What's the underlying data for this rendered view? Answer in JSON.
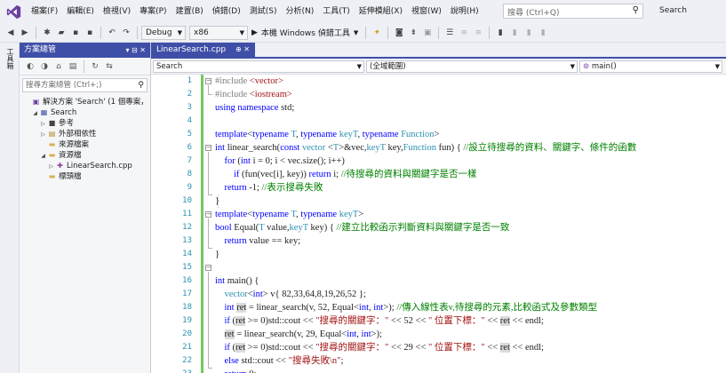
{
  "menu": {
    "items": [
      "檔案(F)",
      "編輯(E)",
      "檢視(V)",
      "專案(P)",
      "建置(B)",
      "偵錯(D)",
      "測試(S)",
      "分析(N)",
      "工具(T)",
      "延伸模組(X)",
      "視窗(W)",
      "說明(H)"
    ],
    "search_placeholder": "搜尋 (Ctrl+Q)",
    "search_label": "Search"
  },
  "toolbar": {
    "config": "Debug",
    "platform": "x86",
    "run_label": "本機 Windows 偵錯工具"
  },
  "side_strip": {
    "label": "工具箱"
  },
  "solution_explorer": {
    "title": "方案總管",
    "title_controls": "▾ ⊟ ✕",
    "search_placeholder": "搜尋方案總管 (Ctrl+;)",
    "tree": [
      {
        "label": "解決方案 'Search' (1 個專案，",
        "icon": "solution-icon",
        "depth": 0,
        "expander": ""
      },
      {
        "label": "Search",
        "icon": "project-icon",
        "depth": 1,
        "expander": "◢"
      },
      {
        "label": "參考",
        "icon": "references-icon",
        "depth": 2,
        "expander": "▷"
      },
      {
        "label": "外部相依性",
        "icon": "external-deps-icon",
        "depth": 2,
        "expander": "▷"
      },
      {
        "label": "來源檔案",
        "icon": "folder-icon",
        "depth": 2,
        "expander": ""
      },
      {
        "label": "資源檔",
        "icon": "folder-icon",
        "depth": 2,
        "expander": "◢"
      },
      {
        "label": "LinearSearch.cpp",
        "icon": "cpp-file-icon",
        "depth": 3,
        "expander": "▷"
      },
      {
        "label": "標頭檔",
        "icon": "folder-icon",
        "depth": 2,
        "expander": ""
      }
    ]
  },
  "editor": {
    "tab_label": "LinearSearch.cpp",
    "tab_pin": "⊕ ✕",
    "nav_project": "Search",
    "nav_scope": "(全域範圍)",
    "nav_member": "main()",
    "line_numbers": [
      "1",
      "2",
      "3",
      "4",
      "5",
      "6",
      "7",
      "8",
      "9",
      "10",
      "11",
      "12",
      "13",
      "14",
      "15",
      "16",
      "17",
      "18",
      "19",
      "20",
      "21",
      "22",
      "23"
    ]
  },
  "colors": {
    "accent": "#3f4fa8",
    "keyword": "#0000ff",
    "type": "#2b91af",
    "string": "#a31515",
    "comment": "#008000",
    "change_bar": "#71c95f"
  }
}
